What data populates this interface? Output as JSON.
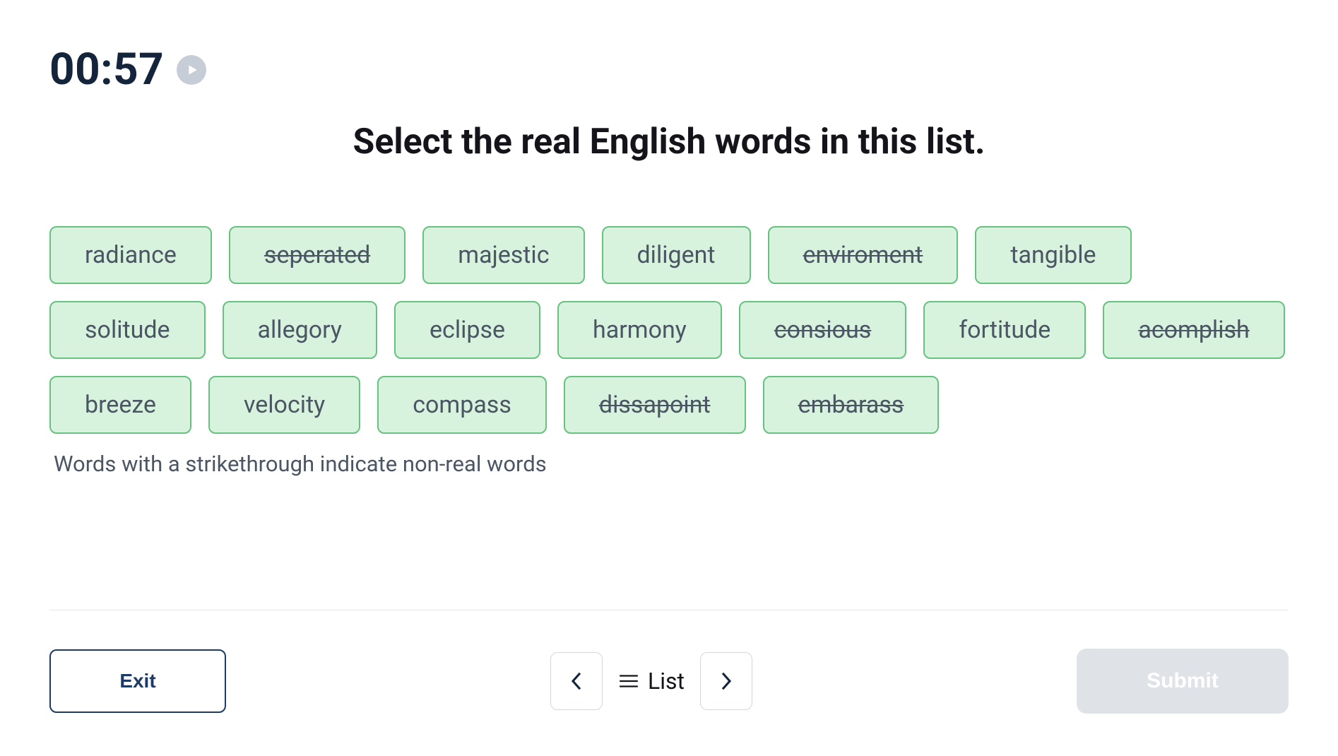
{
  "timer": "00:57",
  "title": "Select the real English words in this list.",
  "words": [
    {
      "text": "radiance",
      "strike": false
    },
    {
      "text": "seperated",
      "strike": true
    },
    {
      "text": "majestic",
      "strike": false
    },
    {
      "text": "diligent",
      "strike": false
    },
    {
      "text": "enviroment",
      "strike": true
    },
    {
      "text": "tangible",
      "strike": false
    },
    {
      "text": "solitude",
      "strike": false
    },
    {
      "text": "allegory",
      "strike": false
    },
    {
      "text": "eclipse",
      "strike": false
    },
    {
      "text": "harmony",
      "strike": false
    },
    {
      "text": "consious",
      "strike": true
    },
    {
      "text": "fortitude",
      "strike": false
    },
    {
      "text": "acomplish",
      "strike": true
    },
    {
      "text": "breeze",
      "strike": false
    },
    {
      "text": "velocity",
      "strike": false
    },
    {
      "text": "compass",
      "strike": false
    },
    {
      "text": "dissapoint",
      "strike": true
    },
    {
      "text": "embarass",
      "strike": true
    }
  ],
  "hint": "Words with a strikethrough indicate non-real words",
  "footer": {
    "exit": "Exit",
    "list": "List",
    "submit": "Submit"
  }
}
